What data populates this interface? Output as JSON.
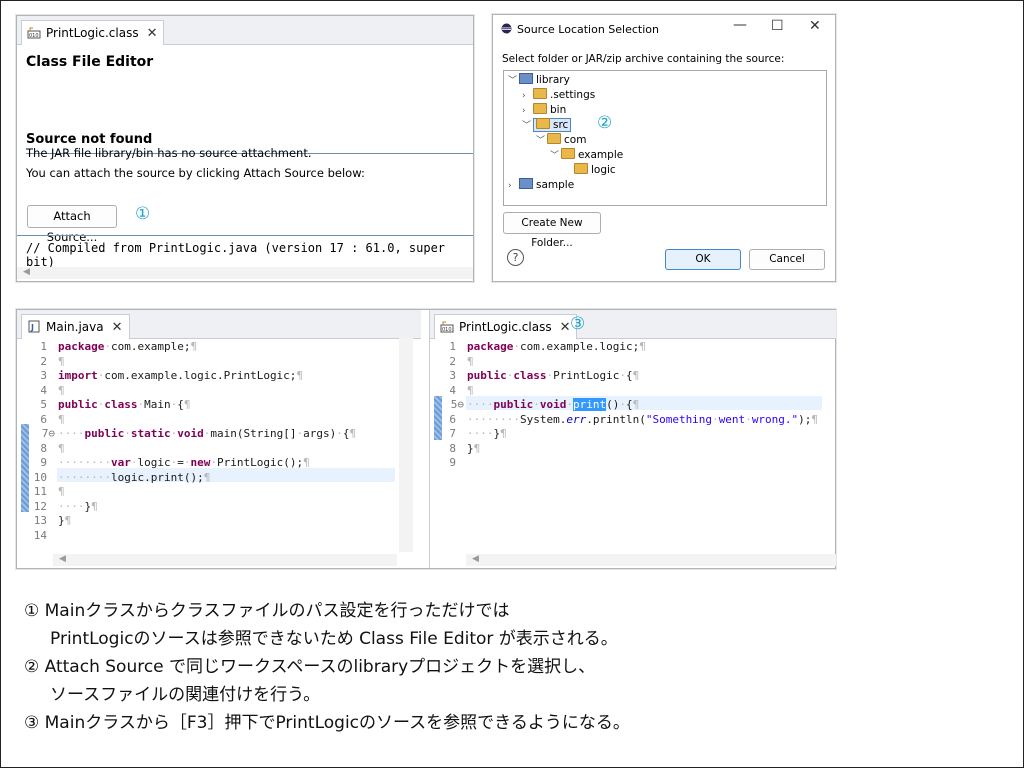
{
  "panel1": {
    "tab_title": "PrintLogic.class",
    "editor_title": "Class File Editor",
    "section_title": "Source not found",
    "line1": "The JAR file library/bin has no source attachment.",
    "line2": "You can attach the source by clicking Attach Source below:",
    "attach_button": "Attach Source...",
    "marker": "①",
    "compiled_comment": "// Compiled from PrintLogic.java (version 17 : 61.0, super bit)"
  },
  "dialog": {
    "title": "Source Location Selection",
    "prompt": "Select folder or JAR/zip archive containing the source:",
    "tree": [
      {
        "label": "library",
        "chev": "v"
      },
      {
        "label": ".settings",
        "chev": ">"
      },
      {
        "label": "bin",
        "chev": ">"
      },
      {
        "label": "src",
        "chev": "v"
      },
      {
        "label": "com",
        "chev": "v"
      },
      {
        "label": "example",
        "chev": "v"
      },
      {
        "label": "logic",
        "chev": ""
      },
      {
        "label": "sample",
        "chev": ">"
      }
    ],
    "marker": "②",
    "new_folder_button": "Create New Folder...",
    "ok_button": "OK",
    "cancel_button": "Cancel",
    "help": "?"
  },
  "editor_main": {
    "tab_title": "Main.java",
    "line_numbers": [
      "1",
      "2",
      "3",
      "4",
      "5",
      "6",
      "7⊖",
      "8",
      "9",
      "10",
      "11",
      "12",
      "13",
      "14"
    ]
  },
  "editor_print": {
    "tab_title": "PrintLogic.class",
    "marker": "③",
    "line_numbers": [
      "1",
      "2",
      "3",
      "4",
      "5⊖",
      "6",
      "7",
      "8",
      "9"
    ]
  },
  "notes": [
    "① Mainクラスからクラスファイルのパス設定を行っただけでは",
    "PrintLogicのソースは参照できないため Class File Editor が表示される。",
    "② Attach Source で同じワークスペースのlibraryプロジェクトを選択し、",
    "ソースファイルの関連付けを行う。",
    "③ Mainクラスから［F3］押下でPrintLogicのソースを参照できるようになる。"
  ],
  "colors": {
    "keyword": "#7f0055",
    "string": "#2a00ff",
    "marker": "#1fa6c9",
    "selection": "#3399ff"
  }
}
